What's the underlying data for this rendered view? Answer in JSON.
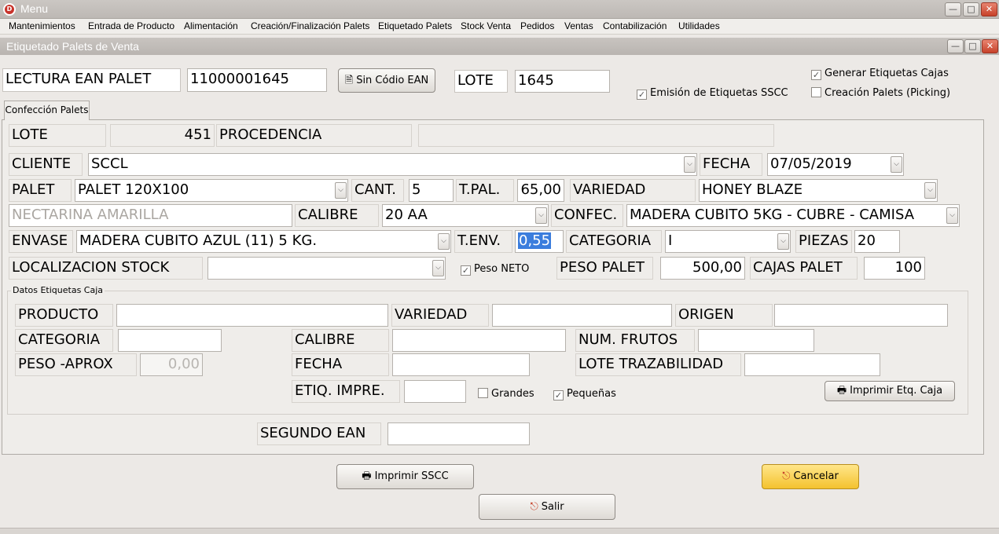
{
  "app": {
    "title": "Menu",
    "icon_letter": "D"
  },
  "menu": [
    "Mantenimientos",
    "Entrada de Producto",
    "Alimentación",
    "Creación/Finalización Palets",
    "Etiquetado Palets",
    "Stock Venta",
    "Pedidos",
    "Ventas",
    "Contabilización",
    "Utilidades"
  ],
  "window": {
    "title": "Etiquetado Palets de Venta"
  },
  "top": {
    "lectura_label": "LECTURA EAN PALET",
    "lectura_value": "11000001645",
    "sin_codigo_label": "Sin Códio EAN",
    "lote_label": "LOTE",
    "lote_value": "1645",
    "chk_generar": "Generar Etiquetas Cajas",
    "chk_emision": "Emisión de Etiquetas SSCC",
    "chk_creacion": "Creación Palets (Picking)"
  },
  "tab": {
    "label": "Confección Palets"
  },
  "form": {
    "lote_label": "LOTE",
    "lote_value": "451",
    "procedencia_label": "PROCEDENCIA",
    "procedencia_value": "",
    "cliente_label": "CLIENTE",
    "cliente_value": "SCCL",
    "fecha_label": "FECHA",
    "fecha_value": "07/05/2019",
    "palet_label": "PALET",
    "palet_value": "PALET 120X100",
    "cant_label": "CANT.",
    "cant_value": "5",
    "tpal_label": "T.PAL.",
    "tpal_value": "65,00",
    "variedad_label": "VARIEDAD",
    "variedad_value": "HONEY BLAZE",
    "producto_value": "NECTARINA AMARILLA",
    "calibre_label": "CALIBRE",
    "calibre_value": "20 AA",
    "confec_label": "CONFEC.",
    "confec_value": "MADERA CUBITO 5KG - CUBRE - CAMISA",
    "envase_label": "ENVASE",
    "envase_value": "MADERA CUBITO AZUL (11) 5 KG.",
    "tenv_label": "T.ENV.",
    "tenv_value": "0,55",
    "categoria_label": "CATEGORIA",
    "categoria_value": "I",
    "piezas_label": "PIEZAS",
    "piezas_value": "20",
    "localizacion_label": "LOCALIZACION STOCK",
    "localizacion_value": "",
    "peso_neto_label": "Peso NETO",
    "peso_palet_label": "PESO PALET",
    "peso_palet_value": "500,00",
    "cajas_palet_label": "CAJAS PALET",
    "cajas_palet_value": "100"
  },
  "caja": {
    "group_title": "Datos Etiquetas Caja",
    "producto_label": "PRODUCTO",
    "variedad_label": "VARIEDAD",
    "origen_label": "ORIGEN",
    "categoria_label": "CATEGORIA",
    "calibre_label": "CALIBRE",
    "num_frutos_label": "NUM. FRUTOS",
    "peso_label": "PESO -APROX",
    "peso_value": "0,00",
    "fecha_label": "FECHA",
    "lote_traz_label": "LOTE TRAZABILIDAD",
    "etiq_label": "ETIQ. IMPRE.",
    "grandes_label": "Grandes",
    "pequenas_label": "Pequeñas",
    "imprimir_label": "Imprimir Etq. Caja"
  },
  "segundo_ean_label": "SEGUNDO EAN",
  "buttons": {
    "imprimir_sscc": "Imprimir SSCC",
    "cancelar": "Cancelar",
    "salir": "Salir"
  },
  "colors": {
    "accent_yellow": "#f4c22e",
    "close_red": "#c7422a",
    "selection": "#3b7ddd"
  }
}
